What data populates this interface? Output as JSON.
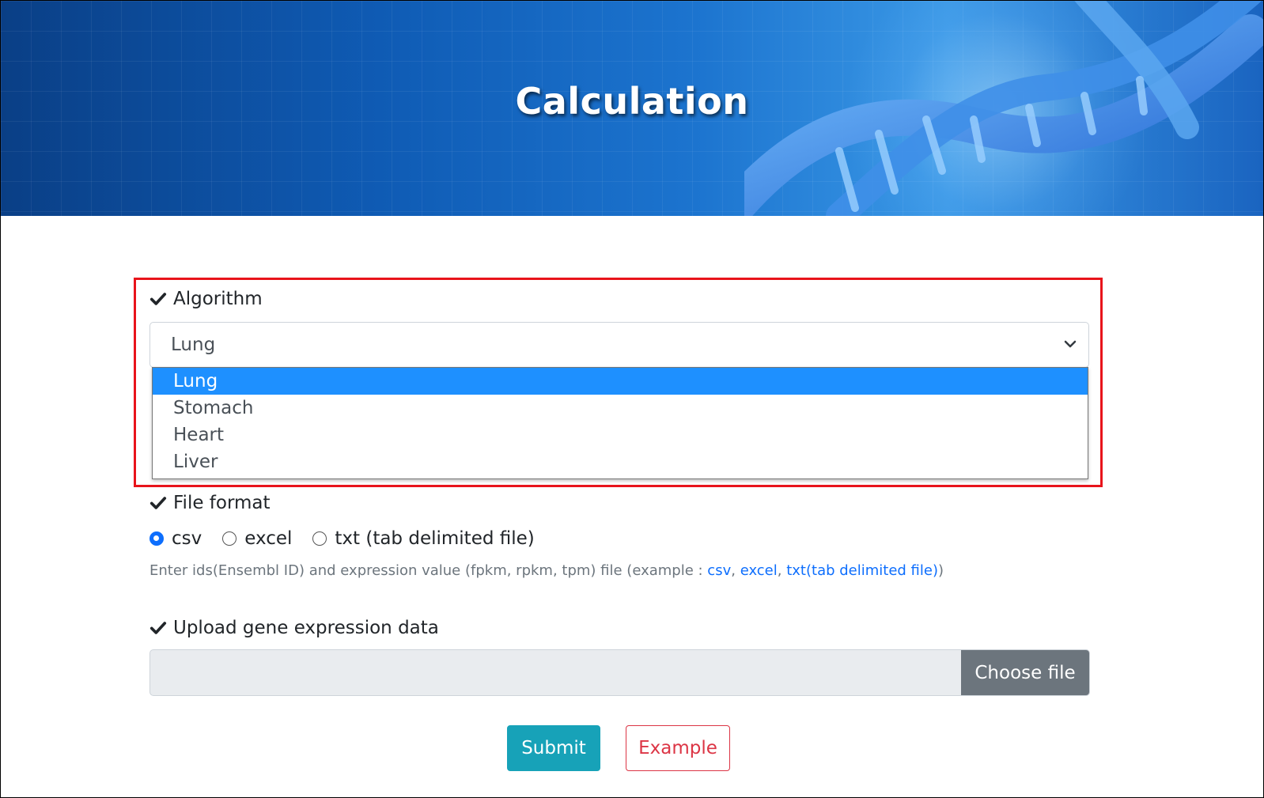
{
  "banner": {
    "title": "Calculation"
  },
  "algorithm": {
    "label": "Algorithm",
    "selected": "Lung",
    "options": [
      "Lung",
      "Stomach",
      "Heart",
      "Liver"
    ]
  },
  "file_format": {
    "label": "File format",
    "options": [
      {
        "label": "csv",
        "checked": true
      },
      {
        "label": "excel",
        "checked": false
      },
      {
        "label": "txt (tab delimited file)",
        "checked": false
      }
    ],
    "help_prefix": "Enter ids(Ensembl ID) and expression value (fpkm, rpkm, tpm) file (example : ",
    "help_links": [
      "csv",
      "excel",
      "txt(tab delimited file)"
    ],
    "help_suffix": ")"
  },
  "upload": {
    "label": "Upload gene expression data",
    "button": "Choose file"
  },
  "actions": {
    "submit": "Submit",
    "example": "Example"
  },
  "colors": {
    "highlight_border": "#e8141b",
    "dropdown_selected": "#1e90ff",
    "submit_bg": "#17a2b8",
    "example_text": "#dc3545",
    "choose_file_bg": "#6c757d",
    "link": "#0d6efd"
  },
  "icons": [
    "check-icon",
    "chevron-down-icon",
    "dna-image"
  ]
}
